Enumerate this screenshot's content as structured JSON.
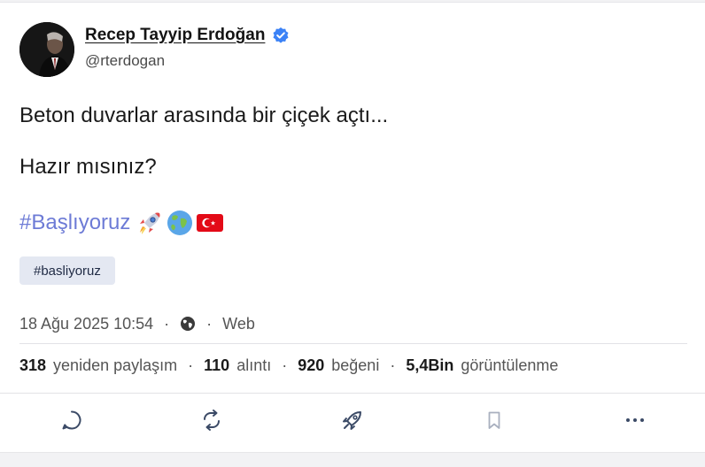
{
  "author": {
    "display_name": "Recep Tayyip Erdoğan",
    "handle": "@rterdogan",
    "verified": true
  },
  "post": {
    "line1": "Beton duvarlar arasında bir çiçek açtı...",
    "line2": "Hazır mısınız?",
    "hashtag": "#Başlıyoruz",
    "emojis": [
      "rocket-emoji",
      "globe-emoji",
      "turkey-flag-emoji"
    ],
    "tag_chip": "#basliyoruz"
  },
  "meta": {
    "date": "18 Ağu 2025 10:54",
    "sep1": "·",
    "visibility_icon": "globe-icon",
    "sep2": "·",
    "source": "Web"
  },
  "stats": {
    "reposts_count": "318",
    "reposts_label": "yeniden paylaşım",
    "quotes_count": "110",
    "quotes_label": "alıntı",
    "likes_count": "920",
    "likes_label": "beğeni",
    "views_count": "5,4Bin",
    "views_label": "görüntülenme",
    "sep": "·"
  },
  "actions": [
    "reply-icon",
    "repost-icon",
    "boost-icon",
    "bookmark-icon",
    "more-icon"
  ],
  "colors": {
    "hashtag": "#6d7bd6",
    "verified": "#3b82f6",
    "chip_bg": "#e4e8f2"
  }
}
